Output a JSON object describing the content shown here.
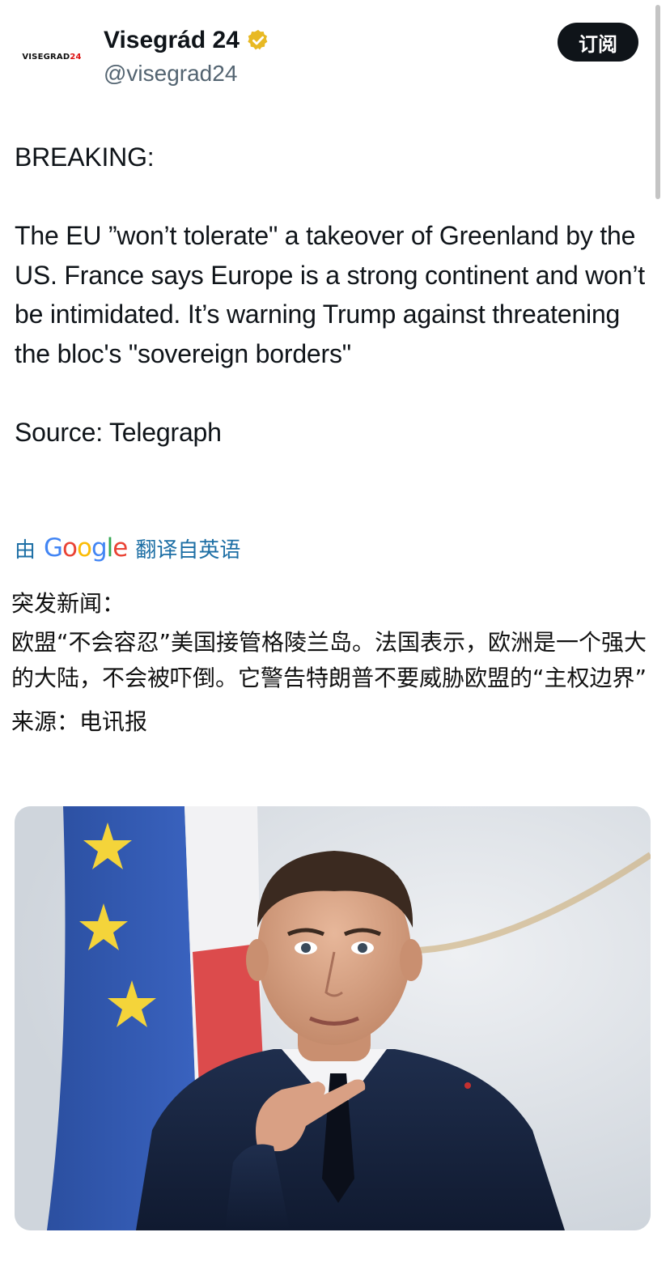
{
  "header": {
    "avatar_logo_text": "VISEGRAD",
    "avatar_logo_num": "24",
    "display_name": "Visegrád 24",
    "handle": "@visegrad24",
    "subscribe_label": "订阅"
  },
  "tweet": {
    "lines": [
      "BREAKING:",
      "The EU ”won’t tolerate\" a takeover of Greenland by the US. France says Europe is a strong continent and won’t be intimidated. It’s warning Trump against threatening the bloc's \"sovereign borders\"",
      "Source: Telegraph"
    ]
  },
  "translate": {
    "prefix": "由",
    "provider": "Google",
    "suffix": "翻译自英语"
  },
  "translation": {
    "lines": [
      "突发新闻：",
      "欧盟“不会容忍”美国接管格陵兰岛。法国表示，欧洲是一个强大的大陆，不会被吓倒。它警告特朗普不要威胁欧盟的“主权边界”",
      "来源：电讯报"
    ]
  },
  "colors": {
    "verified_badge": "#e8b923",
    "link_blue": "#1d6fa5",
    "button_bg": "#0f1419"
  },
  "icons": {
    "verified": "verified-badge-icon"
  },
  "media": {
    "alt": "photo"
  }
}
